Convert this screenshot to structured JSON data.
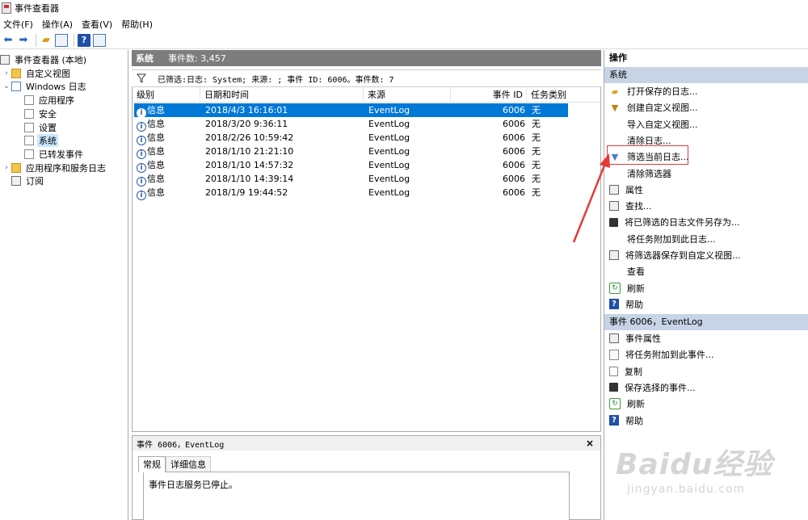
{
  "window": {
    "title": "事件查看器"
  },
  "menu": [
    "文件(F)",
    "操作(A)",
    "查看(V)",
    "帮助(H)"
  ],
  "toolbar": {
    "icons": [
      "back-arrow-icon",
      "forward-arrow-icon",
      "open-folder-icon",
      "show-pane-icon",
      "help-icon",
      "properties-pane-icon"
    ]
  },
  "tree": {
    "root": "事件查看器 (本地)",
    "custom_views": "自定义视图",
    "windows_logs": "Windows 日志",
    "app": "应用程序",
    "security": "安全",
    "setup": "设置",
    "system": "系统",
    "forwarded": "已转发事件",
    "app_services": "应用程序和服务日志",
    "subscriptions": "订阅"
  },
  "center": {
    "header_title": "系统",
    "header_count": "事件数: 3,457",
    "filter_text": "已筛选:日志: System; 来源: ; 事件 ID: 6006。事件数: 7",
    "columns": {
      "level": "级别",
      "datetime": "日期和时间",
      "source": "来源",
      "event_id": "事件 ID",
      "task": "任务类别"
    },
    "rows": [
      {
        "level": "信息",
        "datetime": "2018/4/3 16:16:01",
        "source": "EventLog",
        "event_id": "6006",
        "task": "无"
      },
      {
        "level": "信息",
        "datetime": "2018/3/20 9:36:11",
        "source": "EventLog",
        "event_id": "6006",
        "task": "无"
      },
      {
        "level": "信息",
        "datetime": "2018/2/26 10:59:42",
        "source": "EventLog",
        "event_id": "6006",
        "task": "无"
      },
      {
        "level": "信息",
        "datetime": "2018/1/10 21:21:10",
        "source": "EventLog",
        "event_id": "6006",
        "task": "无"
      },
      {
        "level": "信息",
        "datetime": "2018/1/10 14:57:32",
        "source": "EventLog",
        "event_id": "6006",
        "task": "无"
      },
      {
        "level": "信息",
        "datetime": "2018/1/10 14:39:14",
        "source": "EventLog",
        "event_id": "6006",
        "task": "无"
      },
      {
        "level": "信息",
        "datetime": "2018/1/9 19:44:52",
        "source": "EventLog",
        "event_id": "6006",
        "task": "无"
      }
    ],
    "detail_title": "事件 6006，EventLog",
    "detail_close": "×",
    "tab_general": "常规",
    "tab_details": "详细信息",
    "detail_message": "事件日志服务已停止。"
  },
  "actions": {
    "header": "操作",
    "section1": "系统",
    "section1_items": [
      {
        "label": "打开保存的日志...",
        "icon": "folder-open-icon"
      },
      {
        "label": "创建自定义视图...",
        "icon": "filter-icon"
      },
      {
        "label": "导入自定义视图...",
        "icon": ""
      },
      {
        "label": "清除日志...",
        "icon": ""
      },
      {
        "label": "筛选当前日志...",
        "icon": "funnel-icon"
      },
      {
        "label": "清除筛选器",
        "icon": ""
      },
      {
        "label": "属性",
        "icon": "properties-icon"
      },
      {
        "label": "查找...",
        "icon": "find-icon"
      },
      {
        "label": "将已筛选的日志文件另存为...",
        "icon": "save-icon"
      },
      {
        "label": "将任务附加到此日志...",
        "icon": ""
      },
      {
        "label": "将筛选器保存到自定义视图...",
        "icon": "save-filter-icon"
      },
      {
        "label": "查看",
        "icon": ""
      },
      {
        "label": "刷新",
        "icon": "refresh-icon"
      },
      {
        "label": "帮助",
        "icon": "help-icon"
      }
    ],
    "section2": "事件 6006，EventLog",
    "section2_items": [
      {
        "label": "事件属性",
        "icon": "event-properties-icon"
      },
      {
        "label": "将任务附加到此事件...",
        "icon": "attach-task-icon"
      },
      {
        "label": "复制",
        "icon": "copy-icon"
      },
      {
        "label": "保存选择的事件...",
        "icon": "save-icon"
      },
      {
        "label": "刷新",
        "icon": "refresh-icon"
      },
      {
        "label": "帮助",
        "icon": "help-icon"
      }
    ]
  },
  "watermark": {
    "brand": "Baidu经验",
    "url": "jingyan.baidu.com"
  },
  "colors": {
    "selection": "#0078d7",
    "section_header": "#c6d4e6",
    "highlight_box": "#e23b3b"
  }
}
